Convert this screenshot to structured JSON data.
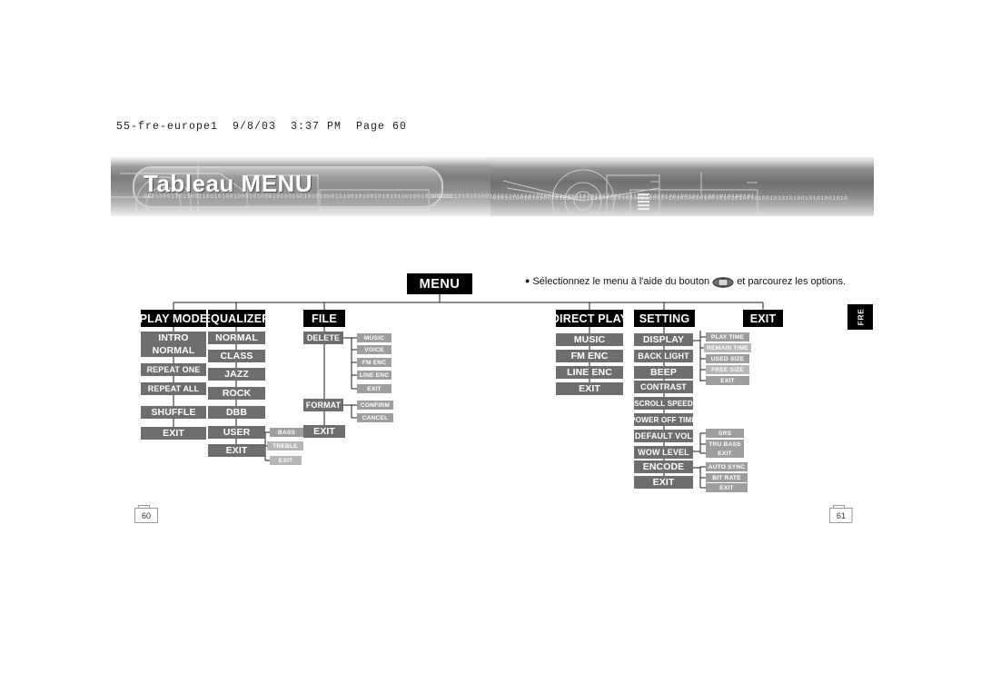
{
  "print_header": "55-fre-europe1  9/8/03  3:37 PM  Page 60",
  "banner": {
    "title": "Tableau MENU"
  },
  "language_tab": "FRE",
  "page_numbers": {
    "left": "60",
    "right": "61"
  },
  "menu": {
    "root_label": "MENU",
    "note_bullet": "●",
    "note_before": "Sélectionnez le menu à l'aide du bouton",
    "note_icon": "rocker-button-icon",
    "note_after": "et parcourez les options."
  },
  "columns": [
    {
      "head": "PLAY MODE",
      "items": [
        "INTRO",
        "NORMAL",
        "REPEAT ONE",
        "REPEAT ALL",
        "SHUFFLE",
        "EXIT"
      ]
    },
    {
      "head": "EQUALIZER",
      "items": [
        "NORMAL",
        "CLASS",
        "JAZZ",
        "ROCK",
        "DBB",
        "USER",
        "EXIT"
      ],
      "sub": {
        "parent": "USER",
        "items": [
          "BASS",
          "TREBLE",
          "EXIT"
        ]
      }
    },
    {
      "head": "FILE",
      "items": [
        "DELETE",
        "FORMAT",
        "EXIT"
      ],
      "sub_delete": [
        "MUSIC",
        "VOICE",
        "FM ENC",
        "LINE ENC",
        "EXIT"
      ],
      "sub_format": [
        "CONFIRM",
        "CANCEL"
      ]
    },
    {
      "head": "DIRECT PLAY",
      "items": [
        "MUSIC",
        "FM ENC",
        "LINE ENC",
        "EXIT"
      ]
    },
    {
      "head": "SETTING",
      "items": [
        "DISPLAY",
        "BACK LIGHT",
        "BEEP",
        "CONTRAST",
        "SCROLL SPEED",
        "POWER OFF TIME",
        "DEFAULT VOL",
        "WOW LEVEL",
        "ENCODE",
        "EXIT"
      ],
      "sub_display": [
        "PLAY TIME",
        "REMAIN TIME",
        "USED SIZE",
        "FREE SIZE",
        "EXIT"
      ],
      "sub_wow": [
        "SRS",
        "TRU BASS",
        "EXIT"
      ],
      "sub_encode": [
        "AUTO SYNC",
        "BIT RATE",
        "EXIT"
      ]
    },
    {
      "head": "EXIT",
      "items": []
    }
  ],
  "colors": {
    "head_bg": "#000000",
    "main_bg": "#6e6e6e",
    "sub_bg": "#9e9e9e",
    "text": "#ffffff",
    "line": "#1a1a1a"
  }
}
